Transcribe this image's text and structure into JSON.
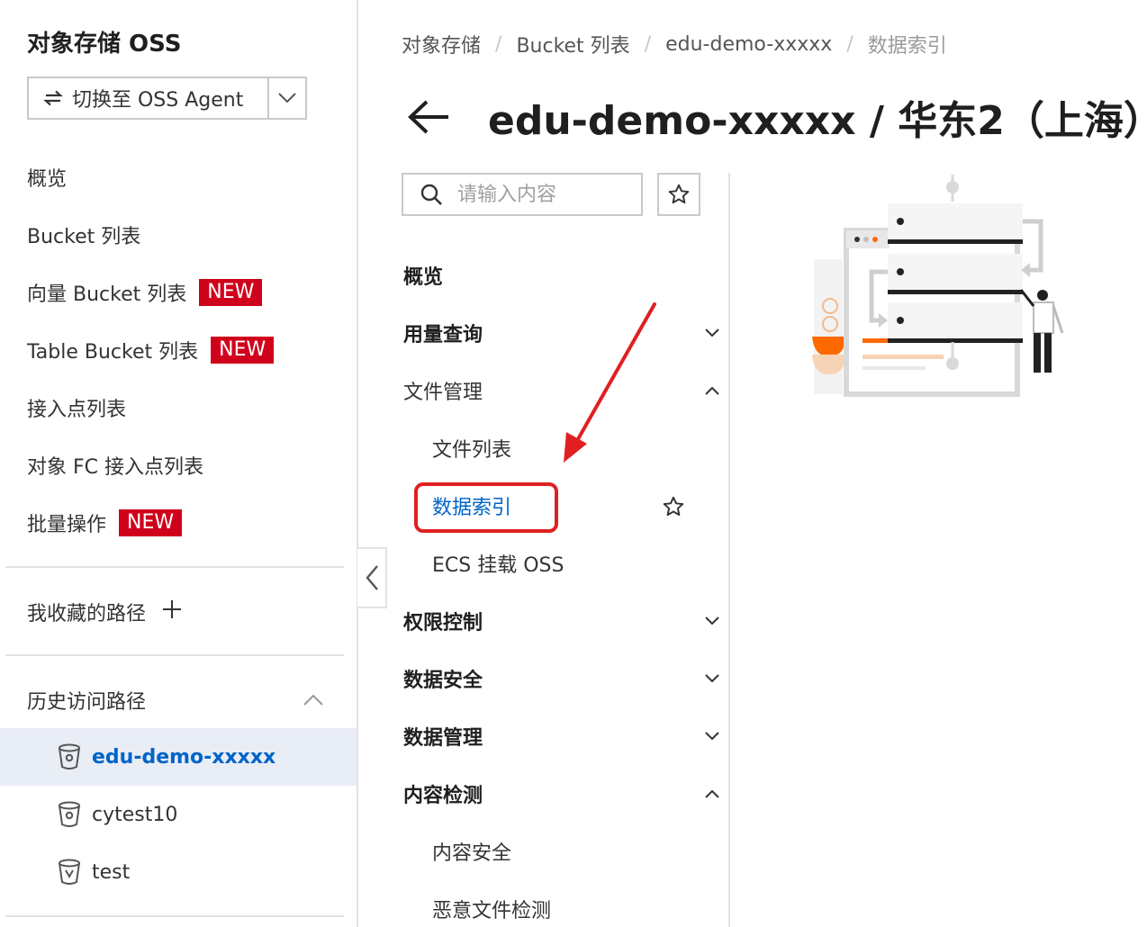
{
  "sidebar": {
    "title": "对象存储 OSS",
    "switch_label": "切换至 OSS Agent",
    "nav": [
      {
        "label": "概览",
        "badge": ""
      },
      {
        "label": "Bucket 列表",
        "badge": ""
      },
      {
        "label": "向量 Bucket 列表",
        "badge": "NEW"
      },
      {
        "label": "Table Bucket 列表",
        "badge": "NEW"
      },
      {
        "label": "接入点列表",
        "badge": ""
      },
      {
        "label": "对象 FC 接入点列表",
        "badge": ""
      },
      {
        "label": "批量操作",
        "badge": "NEW"
      }
    ],
    "favorites_label": "我收藏的路径",
    "history_label": "历史访问路径",
    "history": [
      {
        "label": "edu-demo-xxxxx",
        "active": true
      },
      {
        "label": "cytest10",
        "active": false
      },
      {
        "label": "test",
        "active": false
      }
    ]
  },
  "breadcrumb": [
    "对象存储",
    "Bucket 列表",
    "edu-demo-xxxxx",
    "数据索引"
  ],
  "page_title": "edu-demo-xxxxx / 华东2（上海）",
  "search": {
    "placeholder": "请输入内容"
  },
  "menu": {
    "overview": "概览",
    "usage_query": "用量查询",
    "file_mgmt": "文件管理",
    "file_list": "文件列表",
    "data_index": "数据索引",
    "ecs_mount": "ECS 挂载 OSS",
    "permission": "权限控制",
    "data_security": "数据安全",
    "data_mgmt": "数据管理",
    "content_detect": "内容检测",
    "content_security": "内容安全",
    "malware_detect": "恶意文件检测"
  },
  "colors": {
    "accent": "#0064c8",
    "badge": "#d0021b",
    "annotation": "#e02020",
    "active_bg": "#e9edf5"
  },
  "icons": {
    "switch": "swap-icon",
    "search": "search-icon",
    "star": "star-icon",
    "bucket": "bucket-icon",
    "back": "arrow-left-icon"
  }
}
